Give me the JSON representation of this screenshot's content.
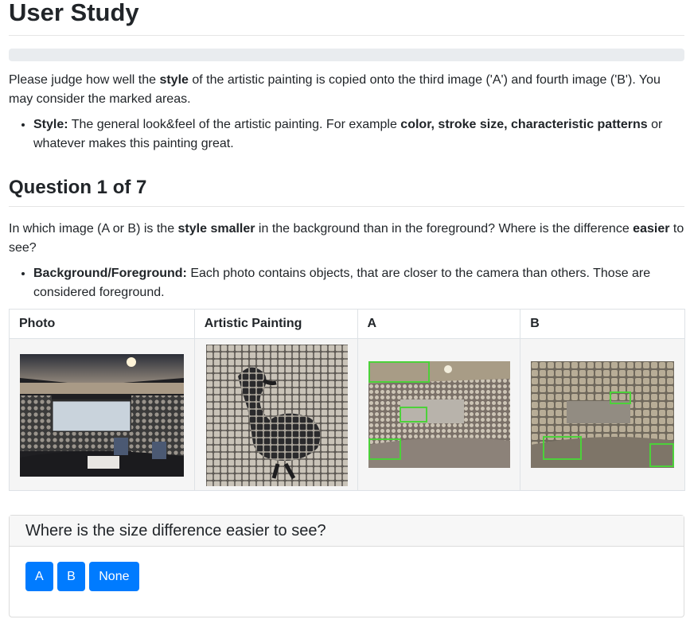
{
  "page": {
    "title": "User Study",
    "progress_value": 0
  },
  "intro": {
    "text_1": "Please judge how well the ",
    "bold_1": "style",
    "text_2": " of the artistic painting is copied onto the third image ('A') and fourth image ('B'). You may consider the marked areas.",
    "bullet_label": "Style:",
    "bullet_text_1": " The general look&feel of the artistic painting. For example ",
    "bullet_bold": "color, stroke size, characteristic patterns",
    "bullet_text_2": " or whatever makes this painting great."
  },
  "question": {
    "heading": "Question 1 of 7",
    "text_1": "In which image (A or B) is the ",
    "bold_1": "style smaller",
    "text_2": " in the background than in the foreground? Where is the difference ",
    "bold_2": "easier",
    "text_3": " to see?",
    "bullet_label": "Background/Foreground:",
    "bullet_text": " Each photo contains objects, that are closer to the camera than others. Those are considered foreground."
  },
  "table": {
    "headers": [
      "Photo",
      "Artistic Painting",
      "A",
      "B"
    ]
  },
  "answer_card": {
    "header": "Where is the size difference easier to see?",
    "buttons": [
      "A",
      "B",
      "None"
    ]
  },
  "colors": {
    "primary": "#007bff",
    "marker": "#4cd13a"
  }
}
